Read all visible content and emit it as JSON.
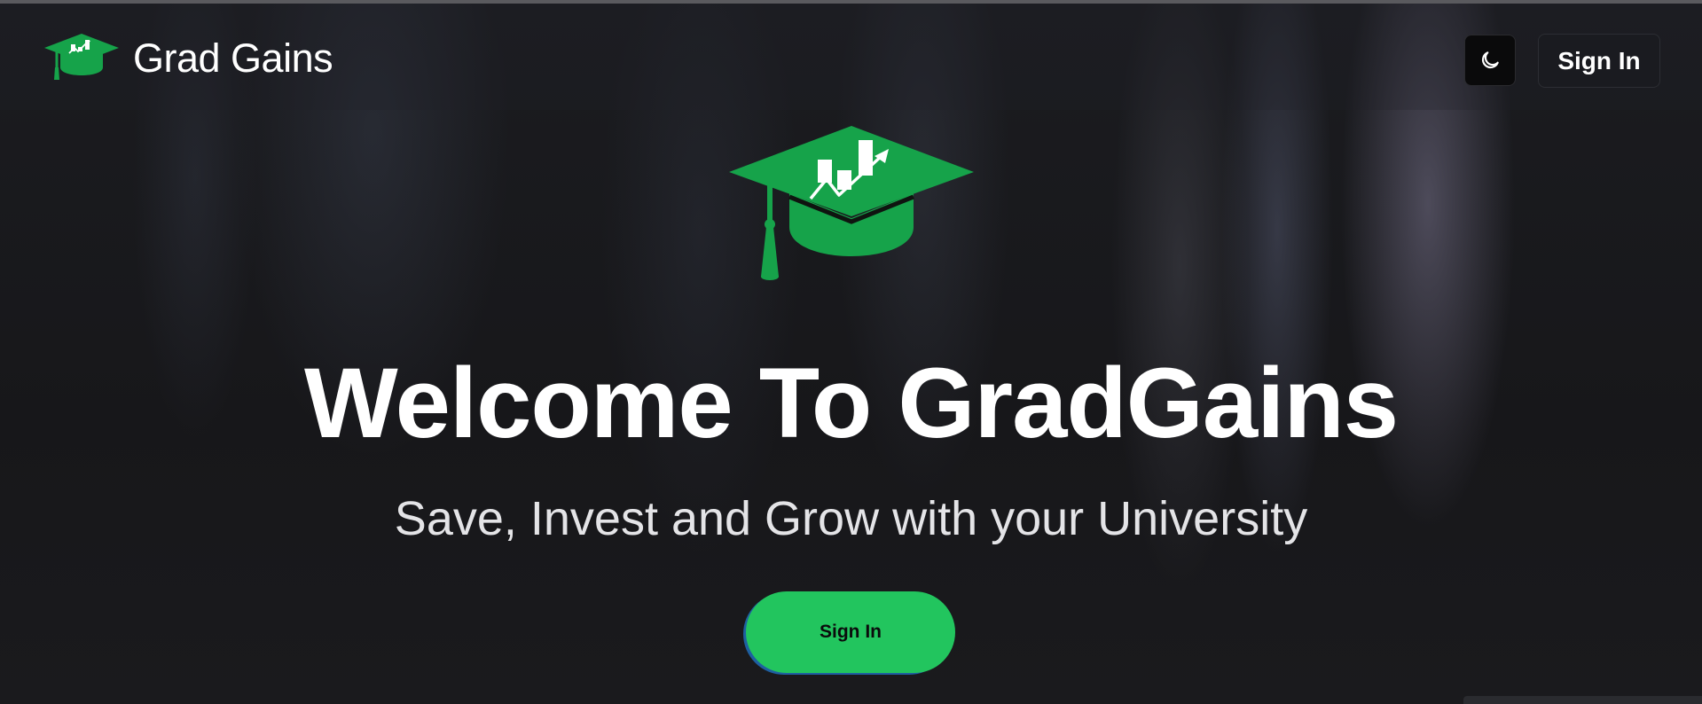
{
  "brand": {
    "name": "Grad Gains",
    "logo_icon": "graduation-cap-growth-icon"
  },
  "header": {
    "theme_toggle_icon": "moon-icon",
    "signin_label": "Sign In"
  },
  "hero": {
    "logo_icon": "graduation-cap-growth-icon",
    "title": "Welcome To GradGains",
    "subtitle": "Save, Invest and Grow with your University",
    "cta_label": "Sign In"
  },
  "colors": {
    "accent": "#22c55e",
    "cap_green": "#16a34a",
    "background": "#17171a",
    "text": "#ffffff"
  }
}
